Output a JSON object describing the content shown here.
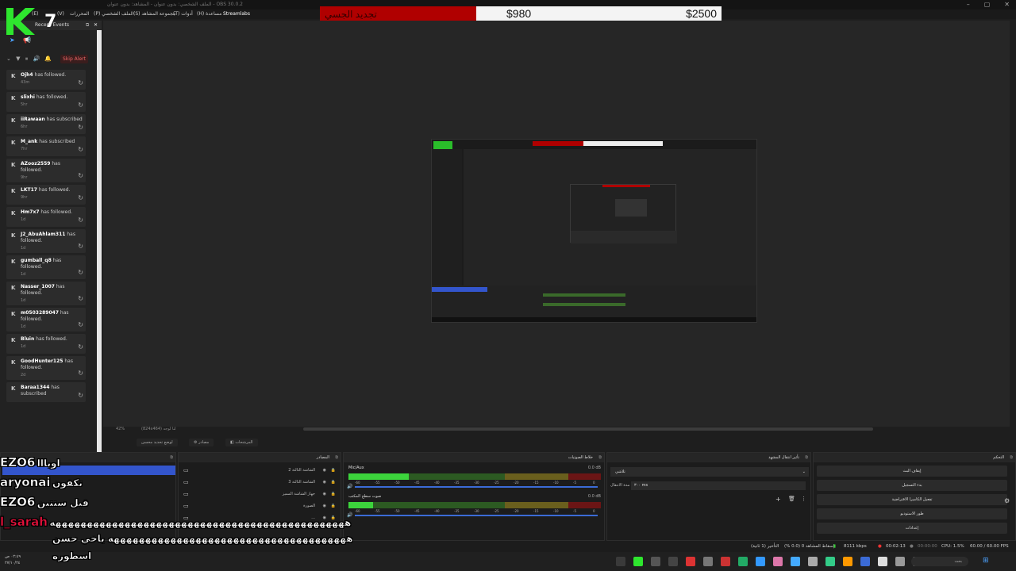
{
  "window": {
    "title": "الملف الشخصي: بدون عنوان - المشاهد: بدون عنوان - OBS 30.0.2"
  },
  "window_controls": {
    "minimize": "–",
    "maximize": "▢",
    "close": "✕"
  },
  "menu": {
    "items": [
      "(V)",
      "(E)",
      "المحررات",
      "(P) الملف الشخصي",
      "(S) مجموعة المشاهد",
      "(T) أدوات",
      "(H) مساعدة",
      "Streamlabs"
    ]
  },
  "goal_bar": {
    "label": "تجديد الجسي",
    "current": "$980",
    "target": "$2500",
    "progress_fraction": 0.39
  },
  "logo": {
    "text": "K7",
    "color": "#2ee62e"
  },
  "dock": {
    "title": "Recent Events",
    "skip_alert": "Skip Alert",
    "events": [
      {
        "user": "Ojh4",
        "action": "has followed.",
        "time": "43m"
      },
      {
        "user": "slixhi",
        "action": "has followed.",
        "time": "5hr"
      },
      {
        "user": "iiRawaan",
        "action": "has subscribed",
        "time": "6hr"
      },
      {
        "user": "M_ank",
        "action": "has subscribed",
        "time": "7hr"
      },
      {
        "user": "AZooz2559",
        "action": "has followed.",
        "time": "9hr"
      },
      {
        "user": "LKT17",
        "action": "has followed.",
        "time": "9hr"
      },
      {
        "user": "Hm7x7",
        "action": "has followed.",
        "time": "1d"
      },
      {
        "user": "J2_AbuAhlam311",
        "action": "has followed.",
        "time": "1d"
      },
      {
        "user": "gumball_q8",
        "action": "has followed.",
        "time": "1d"
      },
      {
        "user": "Nasser_1007",
        "action": "has followed.",
        "time": "1d"
      },
      {
        "user": "m0503289047",
        "action": "has followed.",
        "time": "1d"
      },
      {
        "user": "Bluin",
        "action": "has followed.",
        "time": "1d"
      },
      {
        "user": "GoodHunter125",
        "action": "has followed.",
        "time": "2d"
      },
      {
        "user": "Baraa1344",
        "action": "has subscribed",
        "time": ""
      }
    ]
  },
  "canvas": {
    "zoom": "42%",
    "resolution": "(824x464) لنا لوجه"
  },
  "toolbar2": {
    "transition": "لوضع تحديد محسن",
    "settings": "مصادر",
    "filters": "المرشحات"
  },
  "panels": {
    "scenes": {
      "title": ""
    },
    "sources": {
      "title": "المصادر",
      "items": [
        "الشاشة الثالثة 2",
        "الشاشة الثالثة 3",
        "جهاز الشاشة المميز",
        "الصورة",
        "..."
      ]
    },
    "mixer": {
      "title": "خلاط الصوتيات",
      "channels": [
        {
          "name": "Mic/Aux",
          "db": "0.0 dB",
          "level": 0.75
        },
        {
          "name": "صوت سطح المكتب",
          "db": "0.0 dB",
          "level": 0.3
        }
      ],
      "ticks": [
        "-60",
        "-55",
        "-50",
        "-45",
        "-40",
        "-35",
        "-30",
        "-25",
        "-20",
        "-15",
        "-10",
        "-5",
        "0"
      ]
    },
    "transitions": {
      "title": "تأثير انتقال المشهد",
      "type": "تلاشي",
      "duration_label": "مدة الانتقال",
      "duration": "٣٠٠ ms"
    },
    "controls": {
      "title": "التحكم",
      "buttons": [
        "إيقاف البث",
        "بدء التسجيل",
        "تفعيل الكاميرا الافتراضية",
        "طور الاستوديو",
        "إعدادات"
      ]
    }
  },
  "status": {
    "dropped": "إسقاط المشاهد 0 (0.0 %)",
    "delay": "التأخير (1 ثانية)",
    "bitrate": "8111 kbps",
    "live_time": "00:02:13",
    "rec_time": "00:00:00",
    "cpu": "CPU: 1.5%",
    "fps": "60.00 / 60.00 FPS"
  },
  "taskbar": {
    "time": "٠٢:٤٩ ص",
    "date": "٢٧/١٠/٢٤",
    "search": "بحث"
  },
  "chat": [
    {
      "user": "EZO6",
      "color": "#ffffff",
      "message": "اويااا"
    },
    {
      "user": "aryonai",
      "color": "#ffffff",
      "message": "تكفون"
    },
    {
      "user": "EZO6",
      "color": "#ffffff",
      "message": "قبل سنتين"
    },
    {
      "user": "l_sarah",
      "color": "#e8113c",
      "message": "هههههههههههههههههههههههههههههههههههههههههههههههه"
    },
    {
      "user": "",
      "color": "#ffffff",
      "message": "ههههههههههههههههههههههههههههههههههههههه ياخي حسن"
    },
    {
      "user": "",
      "color": "#ffffff",
      "message": "اسطوره"
    }
  ]
}
